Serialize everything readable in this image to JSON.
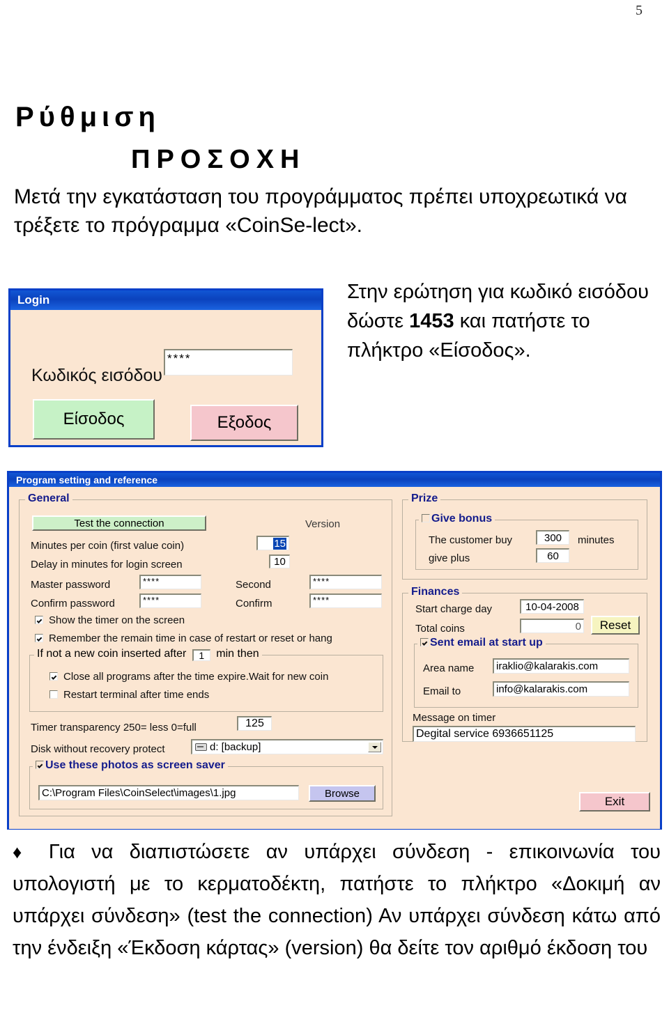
{
  "page": {
    "number": "5"
  },
  "doc": {
    "heading1": "Ρύθμιση",
    "heading2": "ΠΡΟΣΟΧΗ",
    "intro": "Μετά την εγκατάσταση του προγράμματος πρέπει υποχρεωτικά να τρέξετε το πρόγραμμα «CoinSe-lect».",
    "side_pre": "Στην ερώτηση για κωδικό εισόδου δώστε ",
    "side_code": "1453",
    "side_post": " και πατήστε το πλήκτρο «Είσοδος».",
    "bullet_glyph": "♦",
    "bottom": "Για να διαπιστώσετε αν υπάρχει σύνδεση - επικοινωνία του υπολογιστή με το κερματοδέκτη, πατήστε το πλήκτρο «Δοκιμή αν υπάρχει σύνδεση» (test the connection) Αν υπάρχει σύνδεση κάτω από την ένδειξη «Έκδοση κάρτας» (version) θα δείτε τον αριθμό έκδοση του"
  },
  "login_window": {
    "title": "Login",
    "password_label": "Κωδικός εισόδου",
    "password_value": "****",
    "ok_button": "Είσοδος",
    "exit_button": "Εξοδος",
    "colors": {
      "ok": "#c6f2c6",
      "exit": "#f5c6cc",
      "client": "#fbe6d2",
      "title": "#0b42bd"
    }
  },
  "settings_window": {
    "title": "Program setting and reference",
    "general": {
      "legend": "General",
      "test_button": "Test the connection",
      "version_label": "Version",
      "minutes_per_coin_label": "Minutes per coin (first value coin)",
      "minutes_per_coin_value": "15",
      "delay_label": "Delay in minutes for login screen",
      "delay_value": "10",
      "master_password_label": "Master password",
      "master_password_value": "****",
      "confirm_password_label": "Confirm password",
      "confirm_password_value": "****",
      "second_label": "Second",
      "second_value": "****",
      "confirm_label": "Confirm",
      "confirm_value": "****",
      "show_timer_label": "Show the timer on the screen",
      "show_timer_checked": true,
      "remember_label": "Remember the remain time in case of restart or reset or hang",
      "remember_checked": true,
      "coin_group_pre": "If not a new coin inserted after",
      "coin_group_value": "1",
      "coin_group_post": "min then",
      "close_all_label": "Close all programs after the time expire.Wait for new coin",
      "close_all_checked": true,
      "restart_label": "Restart terminal after time ends",
      "restart_checked": false,
      "transparency_label": "Timer transparency  250= less   0=full",
      "transparency_value": "125",
      "disk_label": "Disk without recovery protect",
      "disk_value": "d: [backup]",
      "screensaver_legend": "Use these photos as screen saver",
      "screensaver_checked": true,
      "photo_path": "C:\\Program Files\\CoinSelect\\images\\1.jpg",
      "browse_button": "Browse"
    },
    "prize": {
      "legend": "Prize",
      "give_bonus_legend": "Give bonus",
      "give_bonus_checked": false,
      "customer_buy_label": "The customer buy",
      "customer_buy_value": "300",
      "minutes_unit": "minutes",
      "give_plus_label": "give plus",
      "give_plus_value": "60"
    },
    "finances": {
      "legend": "Finances",
      "start_charge_label": "Start charge day",
      "start_charge_value": "10-04-2008",
      "total_coins_label": "Total coins",
      "total_coins_value": "0",
      "reset_button": "Reset",
      "sent_email_legend": "Sent email at start up",
      "sent_email_checked": true,
      "area_name_label": "Area name",
      "area_name_value": "iraklio@kalarakis.com",
      "email_to_label": "Email to",
      "email_to_value": "info@kalarakis.com",
      "message_label": "Message on timer",
      "message_value": "Degital service 6936651125"
    },
    "exit_button": "Exit",
    "colors": {
      "title": "#0b42bd",
      "client": "#fbe6d2",
      "test_btn": "#cdf0c8",
      "reset_btn": "#f6f4c0",
      "browse_btn": "#c5c5ef",
      "exit_btn": "#f5c6cc",
      "legend_text": "#141c8c",
      "selection": "#0a46b4"
    }
  }
}
